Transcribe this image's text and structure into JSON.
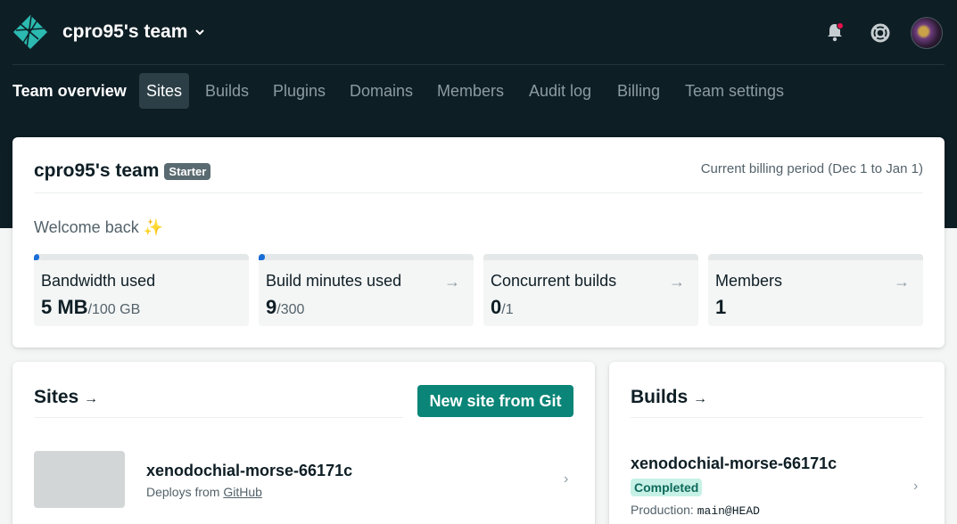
{
  "header": {
    "team_name": "cpro95's team",
    "icons": [
      "netlify-logo-icon",
      "chevron-down-icon",
      "bell-icon",
      "help-icon"
    ],
    "notification_dot_color": "#e8114c"
  },
  "nav": {
    "items": [
      {
        "label": "Team overview"
      },
      {
        "label": "Sites"
      },
      {
        "label": "Builds"
      },
      {
        "label": "Plugins"
      },
      {
        "label": "Domains"
      },
      {
        "label": "Members"
      },
      {
        "label": "Audit log"
      },
      {
        "label": "Billing"
      },
      {
        "label": "Team settings"
      }
    ],
    "selected": "Sites"
  },
  "overview": {
    "team_name": "cpro95's team",
    "plan_badge": "Starter",
    "billing_period": "Current billing period (Dec 1 to Jan 1)",
    "welcome": "Welcome back",
    "welcome_emoji": "✨",
    "stats": [
      {
        "label": "Bandwidth used",
        "value": "5 MB",
        "limit": "/100 GB",
        "progress": 5e-05
      },
      {
        "label": "Build minutes used",
        "value": "9",
        "limit": "/300",
        "progress": 0.03
      },
      {
        "label": "Concurrent builds",
        "value": "0",
        "limit": "/1",
        "progress": 0
      },
      {
        "label": "Members",
        "value": "1",
        "limit": ""
      }
    ],
    "arrow": "→"
  },
  "sites": {
    "title": "Sites",
    "title_arrow": "→",
    "new_button": "New site from Git",
    "items": [
      {
        "name": "xenodochial-morse-66171c",
        "deploys_from": "Deploys from",
        "source": "GitHub"
      }
    ]
  },
  "builds": {
    "title": "Builds",
    "title_arrow": "→",
    "items": [
      {
        "name": "xenodochial-morse-66171c",
        "status": "Completed",
        "context": "Production:",
        "ref": "main@HEAD"
      }
    ]
  },
  "colors": {
    "header_bg": "#0e1e25",
    "accent_teal": "#0a8577",
    "progress_blue": "#1a6ed8",
    "completed_bg": "#c7f1e6"
  }
}
